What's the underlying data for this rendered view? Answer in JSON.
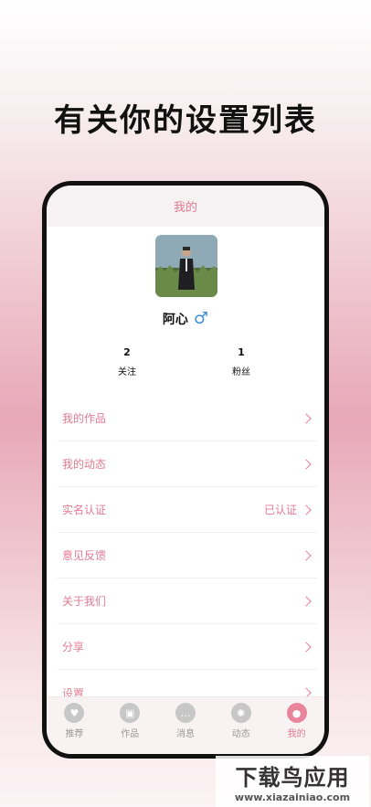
{
  "headline": "有关你的设置列表",
  "header": {
    "title": "我的"
  },
  "profile": {
    "username": "阿心",
    "gender_icon": "♂"
  },
  "stats": [
    {
      "value": "2",
      "label": "关注"
    },
    {
      "value": "1",
      "label": "粉丝"
    }
  ],
  "menu": [
    {
      "label": "我的作品",
      "value": ""
    },
    {
      "label": "我的动态",
      "value": ""
    },
    {
      "label": "实名认证",
      "value": "已认证"
    },
    {
      "label": "意见反馈",
      "value": ""
    },
    {
      "label": "关于我们",
      "value": ""
    },
    {
      "label": "分享",
      "value": ""
    },
    {
      "label": "设置",
      "value": ""
    }
  ],
  "tabs": [
    {
      "label": "推荐",
      "icon": "heart-icon",
      "glyph": "♥"
    },
    {
      "label": "作品",
      "icon": "photo-icon",
      "glyph": "▣"
    },
    {
      "label": "消息",
      "icon": "chat-icon",
      "glyph": "…"
    },
    {
      "label": "动态",
      "icon": "aperture-icon",
      "glyph": "✺"
    },
    {
      "label": "我的",
      "icon": "person-icon",
      "glyph": "●"
    }
  ],
  "active_tab": "我的",
  "watermark": {
    "big": "下载鸟应用",
    "small": "www.xiazainiao.com"
  },
  "colors": {
    "accent": "#e27a93",
    "gender": "#3d8fe0"
  }
}
